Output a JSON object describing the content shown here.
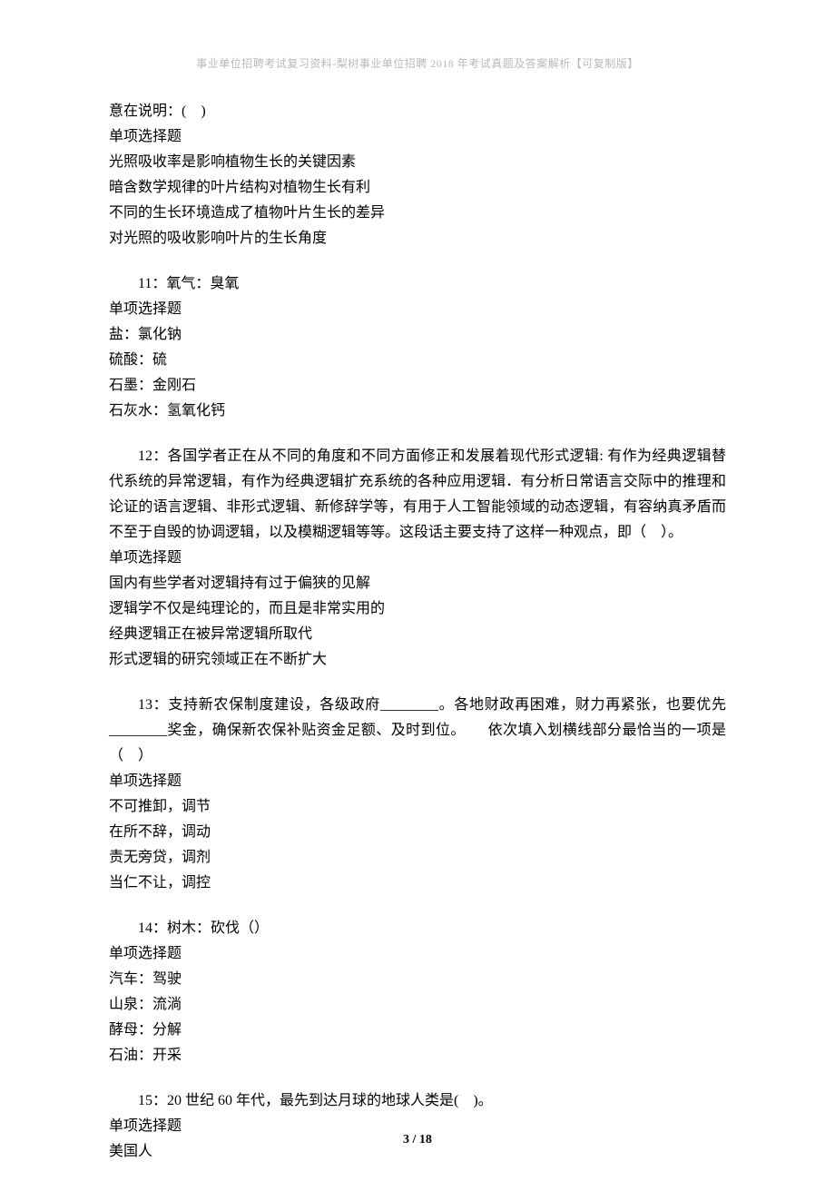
{
  "header": "事业单位招聘考试复习资料-梨树事业单位招聘 2018 年考试真题及答案解析【可复制版】",
  "page_number": "3 / 18",
  "q10_tail": {
    "stem_cont": "意在说明：(　)",
    "type": "单项选择题",
    "opts": [
      "光照吸收率是影响植物生长的关键因素",
      "暗含数学规律的叶片结构对植物生长有利",
      "不同的生长环境造成了植物叶片生长的差异",
      "对光照的吸收影响叶片的生长角度"
    ]
  },
  "q11": {
    "stem": "11：氧气：臭氧",
    "type": "单项选择题",
    "opts": [
      "盐：氯化钠",
      "硫酸：硫",
      "石墨：金刚石",
      "石灰水：氢氧化钙"
    ]
  },
  "q12": {
    "stem": "12：各国学者正在从不同的角度和不同方面修正和发展着现代形式逻辑: 有作为经典逻辑替代系统的异常逻辑，有作为经典逻辑扩充系统的各种应用逻辑．有分析日常语言交际中的推理和论证的语言逻辑、非形式逻辑、新修辞学等，有用于人工智能领域的动态逻辑，有容纳真矛盾而不至于自毁的协调逻辑，以及模糊逻辑等等。这段话主要支持了这样一种观点，即（　）。",
    "type": "单项选择题",
    "opts": [
      "国内有些学者对逻辑持有过于偏狭的见解",
      "逻辑学不仅是纯理论的，而且是非常实用的",
      "经典逻辑正在被异常逻辑所取代",
      "形式逻辑的研究领域正在不断扩大"
    ]
  },
  "q13": {
    "stem": "13：支持新农保制度建设，各级政府________。各地财政再困难，财力再紧张，也要优先________奖金，确保新农保补贴资金足额、及时到位。　　依次填入划横线部分最恰当的一项是（　）",
    "type": "单项选择题",
    "opts": [
      "不可推卸，调节",
      "在所不辞，调动",
      "责无旁贷，调剂",
      "当仁不让，调控"
    ]
  },
  "q14": {
    "stem": "14：树木：砍伐（）",
    "type": "单项选择题",
    "opts": [
      "汽车：驾驶",
      "山泉：流淌",
      "酵母：分解",
      "石油：开采"
    ]
  },
  "q15": {
    "stem": "15：20 世纪 60 年代，最先到达月球的地球人类是(　)。",
    "type": "单项选择题",
    "opts": [
      "美国人"
    ]
  }
}
